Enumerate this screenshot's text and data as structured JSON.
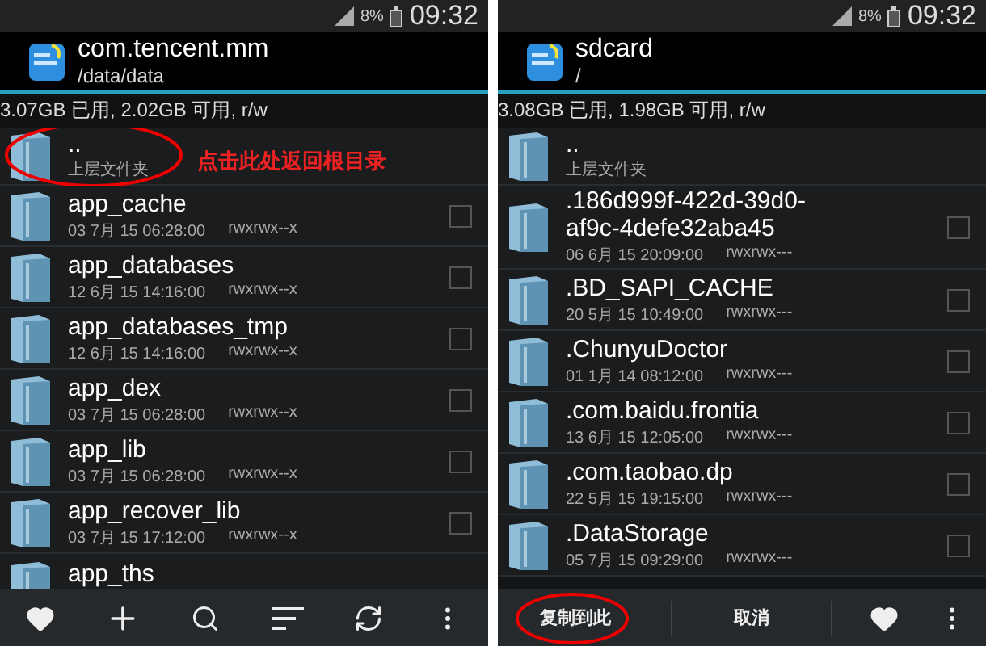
{
  "panels": [
    {
      "status_bar": {
        "battery": "8%",
        "time": "09:32"
      },
      "header": {
        "title": "com.tencent.mm",
        "path": "/data/data"
      },
      "storage": "3.07GB 已用, 2.02GB 可用, r/w",
      "annotation": "点击此处返回根目录",
      "files": [
        {
          "kind": "parent",
          "name": "..",
          "meta": "上层文件夹",
          "circled": true
        },
        {
          "kind": "folder",
          "name": "app_cache",
          "date": "03 7月 15 06:28:00",
          "perms": "rwxrwx--x",
          "checked": false
        },
        {
          "kind": "folder",
          "name": "app_databases",
          "date": "12 6月 15 14:16:00",
          "perms": "rwxrwx--x",
          "checked": false
        },
        {
          "kind": "folder",
          "name": "app_databases_tmp",
          "date": "12 6月 15 14:16:00",
          "perms": "rwxrwx--x",
          "checked": false
        },
        {
          "kind": "folder",
          "name": "app_dex",
          "date": "03 7月 15 06:28:00",
          "perms": "rwxrwx--x",
          "checked": false
        },
        {
          "kind": "folder",
          "name": "app_lib",
          "date": "03 7月 15 06:28:00",
          "perms": "rwxrwx--x",
          "checked": false
        },
        {
          "kind": "folder",
          "name": "app_recover_lib",
          "date": "03 7月 15 17:12:00",
          "perms": "rwxrwx--x",
          "checked": false
        },
        {
          "kind": "partial",
          "name": "app_ths"
        }
      ],
      "toolbar": {
        "kind": "browse"
      }
    },
    {
      "status_bar": {
        "battery": "8%",
        "time": "09:32"
      },
      "header": {
        "title": "sdcard",
        "path": "/"
      },
      "storage": "3.08GB 已用, 1.98GB 可用, r/w",
      "files": [
        {
          "kind": "parent",
          "name": "..",
          "meta": "上层文件夹",
          "circled": false
        },
        {
          "kind": "folder",
          "name": ".186d999f-422d-39d0-af9c-4defe32aba45",
          "date": "06 6月 15 20:09:00",
          "perms": "rwxrwx---",
          "checked": false
        },
        {
          "kind": "folder",
          "name": ".BD_SAPI_CACHE",
          "date": "20 5月 15 10:49:00",
          "perms": "rwxrwx---",
          "checked": false
        },
        {
          "kind": "folder",
          "name": ".ChunyuDoctor",
          "date": "01 1月 14 08:12:00",
          "perms": "rwxrwx---",
          "checked": false
        },
        {
          "kind": "folder",
          "name": ".com.baidu.frontia",
          "date": "13 6月 15 12:05:00",
          "perms": "rwxrwx---",
          "checked": false
        },
        {
          "kind": "folder",
          "name": ".com.taobao.dp",
          "date": "22 5月 15 19:15:00",
          "perms": "rwxrwx---",
          "checked": false
        },
        {
          "kind": "folder",
          "name": ".DataStorage",
          "date": "05 7月 15 09:29:00",
          "perms": "rwxrwx---",
          "checked": false
        }
      ],
      "toolbar": {
        "kind": "paste",
        "buttons": [
          {
            "label": "复制到此",
            "circled": true
          },
          {
            "label": "取消",
            "circled": false
          }
        ]
      }
    }
  ]
}
